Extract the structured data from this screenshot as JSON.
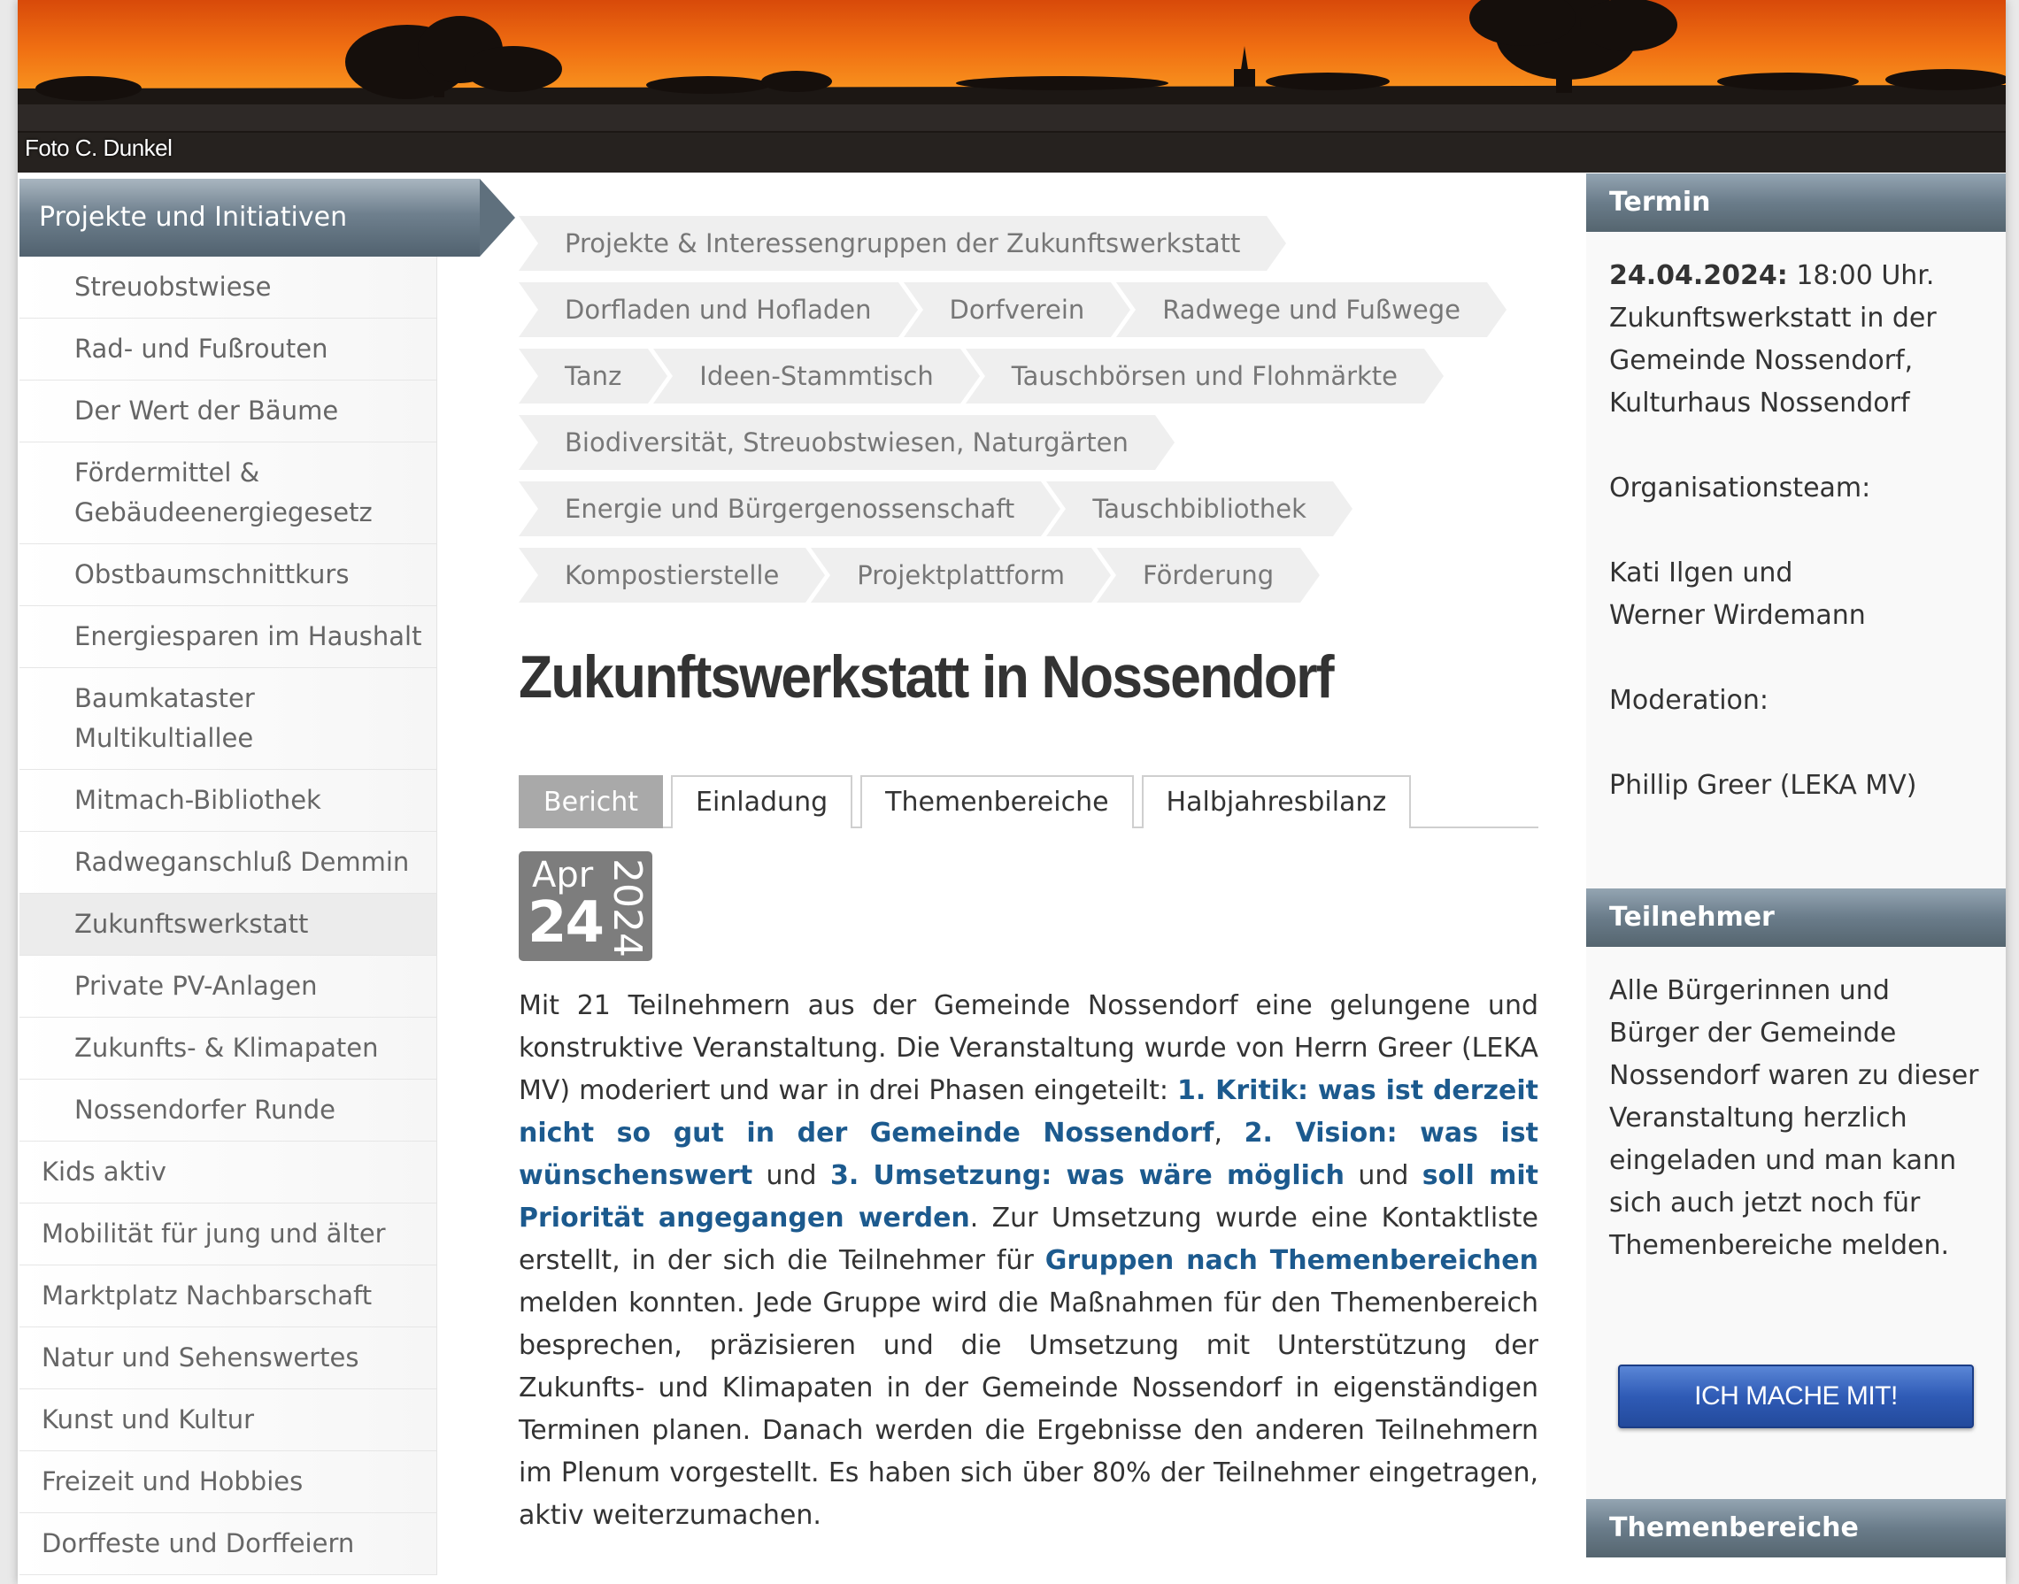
{
  "banner": {
    "photo_credit": "Foto C. Dunkel"
  },
  "sidebar": {
    "heading": "Projekte und Initiativen",
    "sub_items": [
      "Streuobstwiese",
      "Rad- und Fußrouten",
      "Der Wert der Bäume",
      "Fördermittel & Gebäudeenergiegesetz",
      "Obstbaumschnittkurs",
      "Energiesparen im Haushalt",
      "Baumkataster Multikultiallee",
      "Mitmach-Bibliothek",
      "Radweganschluß Demmin",
      "Zukunftswerkstatt",
      "Private PV-Anlagen",
      "Zukunfts- & Klimapaten",
      "Nossendorfer Runde"
    ],
    "active_item": "Zukunftswerkstatt",
    "top_items": [
      "Kids aktiv",
      "Mobilität für jung und älter",
      "Marktplatz Nachbarschaft",
      "Natur und Sehenswertes",
      "Kunst und Kultur",
      "Freizeit und Hobbies",
      "Dorffeste und Dorffeiern"
    ]
  },
  "tags": [
    [
      "Projekte & Interessengruppen der Zukunftswerkstatt"
    ],
    [
      "Dorfladen und Hofladen",
      "Dorfverein",
      "Radwege und Fußwege"
    ],
    [
      "Tanz",
      "Ideen-Stammtisch",
      "Tauschbörsen und Flohmärkte"
    ],
    [
      "Biodiversität, Streuobstwiesen, Naturgärten"
    ],
    [
      "Energie und Bürgergenossenschaft",
      "Tauschbibliothek"
    ],
    [
      "Kompostierstelle",
      "Projektplattform",
      "Förderung"
    ]
  ],
  "title": "Zukunftswerkstatt in Nossendorf",
  "tabs": [
    {
      "label": "Bericht",
      "active": true
    },
    {
      "label": "Einladung",
      "active": false
    },
    {
      "label": "Themenbereiche",
      "active": false
    },
    {
      "label": "Halbjahresbilanz",
      "active": false
    }
  ],
  "date": {
    "month": "Apr",
    "day": "24",
    "year": "2024"
  },
  "article": {
    "p1": "Mit 21 Teilnehmern aus der Gemeinde Nossendorf eine gelungene und konstruktive Veranstaltung. Die Veranstaltung wurde von Herrn Greer (LEKA MV) moderiert und war in drei Phasen eingeteilt: ",
    "link1": "1. Kritik: was ist derzeit nicht so gut in der Gemeinde Nossendorf",
    "sep1": ", ",
    "link2": "2. Vision: was ist wünschenswert",
    "sep2": " und ",
    "link3": "3. Umsetzung: was wäre möglich",
    "sep3": " und ",
    "link4": "soll mit Priorität angegangen werden",
    "p2": ". Zur Umsetzung wurde eine Kontaktliste erstellt, in der sich die Teilnehmer für ",
    "link5": "Gruppen nach Themenbereichen",
    "p3": " melden konnten. Jede Gruppe wird die Maßnahmen für den Themenbereich besprechen, präzisieren und die Umsetzung mit Unterstützung der Zukunfts- und Klimapaten in der Gemeinde Nossendorf in eigenständigen Terminen planen. Danach werden die Ergebnisse den anderen Teilnehmern im Plenum vorgestellt. Es haben sich über 80% der Teilnehmer eingetragen, aktiv weiterzumachen."
  },
  "right": {
    "termin": {
      "heading": "Termin",
      "date": "24.04.2024:",
      "time": " 18:00 Uhr.",
      "location_lines": [
        "Zukunftswerkstatt in der",
        "Gemeinde Nossendorf,",
        "Kulturhaus Nossendorf"
      ],
      "org_label": "Organisationsteam:",
      "org_lines": [
        "Kati Ilgen und",
        "Werner Wirdemann"
      ],
      "mod_label": "Moderation:",
      "mod_name": "Phillip Greer (LEKA MV)"
    },
    "teilnehmer": {
      "heading": "Teilnehmer",
      "lines": [
        "Alle Bürgerinnen und",
        "Bürger der Gemeinde",
        "Nossendorf waren zu dieser",
        "Veranstaltung herzlich",
        "eingeladen und man kann",
        "sich auch jetzt noch für",
        "Themenbereiche melden."
      ],
      "button": "ICH MACHE MIT!"
    },
    "themen": {
      "heading": "Themenbereiche"
    }
  }
}
